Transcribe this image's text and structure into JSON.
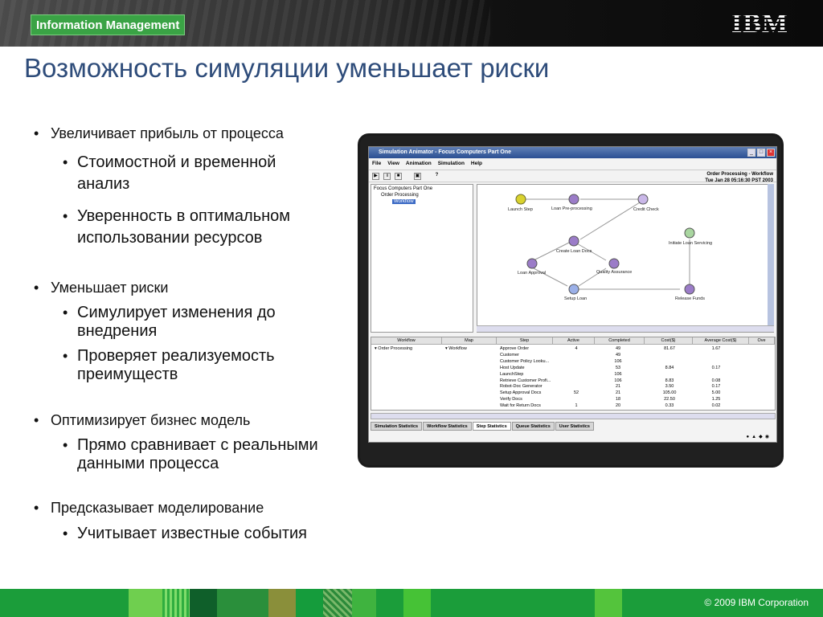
{
  "header": {
    "badge": "Information Management",
    "logo": "IBM"
  },
  "title": "Возможность симуляции уменьшает риски",
  "bullets": [
    {
      "text": "Увеличивает прибыль от процесса",
      "children": [
        "Стоимостной и временной анализ",
        "Уверенность в оптимальном использовании ресурсов"
      ]
    },
    {
      "text": "Уменьшает риски",
      "children": [
        "Симулирует изменения до внедрения",
        "Проверяет реализуемость преимуществ"
      ]
    },
    {
      "text": "Оптимизирует бизнес модель",
      "children": [
        "Прямо сравнивает с реальными данными процесса"
      ]
    },
    {
      "text": "Предсказывает моделирование",
      "children": [
        "Учитывает известные события"
      ]
    }
  ],
  "app": {
    "window_title": "Simulation Animator - Focus Computers Part One",
    "menu": [
      "File",
      "View",
      "Animation",
      "Simulation",
      "Help"
    ],
    "status_line1": "Order Processing - Workflow",
    "status_line2": "Tue Jan 28 05:16:30 PST 2003",
    "tree": [
      "Focus Computers Part One",
      "Order Processing",
      "Workflow"
    ],
    "nodes": {
      "launch": "Launch Step",
      "preproc": "Loan Pre-processing",
      "credit": "Credit Check",
      "create": "Create Loan Docs",
      "approval": "Loan Approval",
      "quality": "Quality Assurance",
      "servicing": "Initiate Loan Servicing",
      "setup": "Setup Loan",
      "release": "Release Funds"
    },
    "table": {
      "headers": [
        "Workflow",
        "Map",
        "Step",
        "Active",
        "Completed",
        "Cost($)",
        "Average Cost($)",
        "Ove"
      ],
      "workflow": "Order Processing",
      "map": "Workflow",
      "rows": [
        [
          "Approve Order",
          "4",
          "49",
          "81.67",
          "1.67"
        ],
        [
          "Customer",
          "",
          "49",
          "",
          ""
        ],
        [
          "Customer Policy Looku...",
          "",
          "106",
          "",
          ""
        ],
        [
          "Host Update",
          "",
          "53",
          "8.84",
          "0.17"
        ],
        [
          "LaunchStep",
          "",
          "106",
          "",
          ""
        ],
        [
          "Retrieve Customer Profi...",
          "",
          "106",
          "8.83",
          "0.08"
        ],
        [
          "Robot-Doc Generator",
          "",
          "21",
          "3.50",
          "0.17"
        ],
        [
          "Setup Approval Docs",
          "52",
          "21",
          "105.00",
          "5.00"
        ],
        [
          "Verify Docs",
          "",
          "18",
          "22.50",
          "1.25"
        ],
        [
          "Wait for Return Docs",
          "1",
          "20",
          "0.33",
          "0.02"
        ]
      ]
    },
    "tabs": [
      "Simulation Statistics",
      "Workflow Statistics",
      "Step Statistics",
      "Queue Statistics",
      "User Statistics"
    ]
  },
  "footer": {
    "copyright": "© 2009  IBM Corporation"
  }
}
